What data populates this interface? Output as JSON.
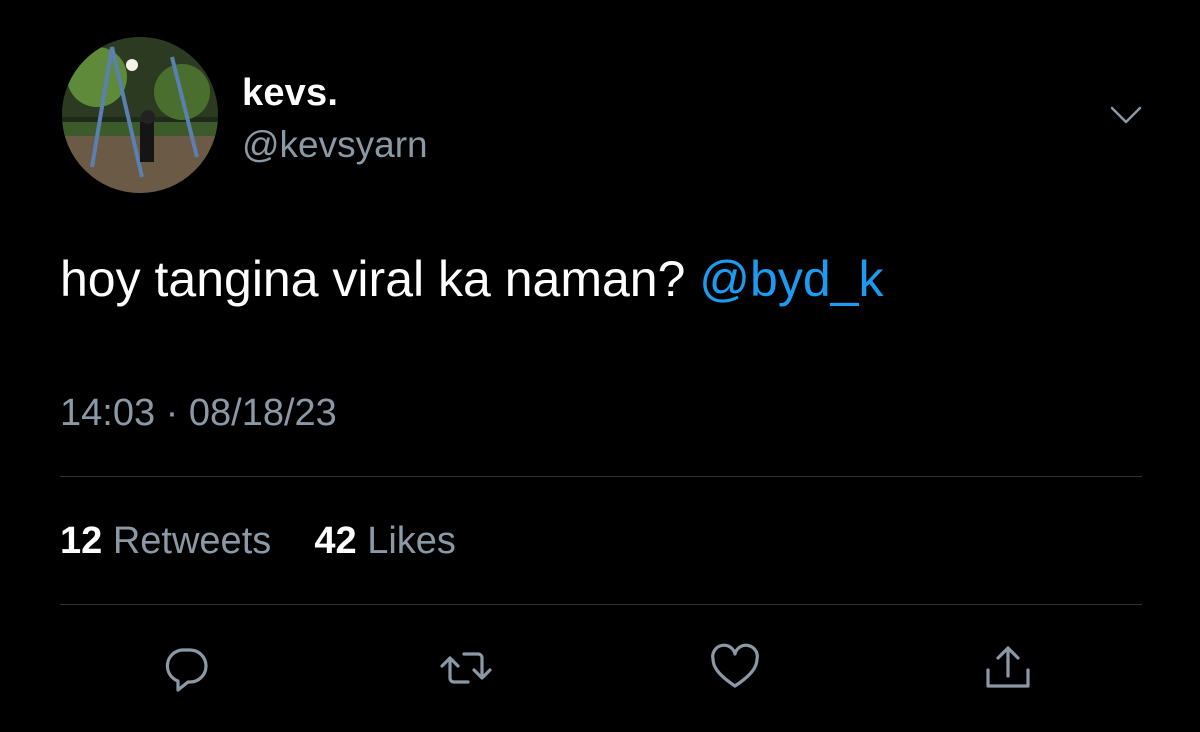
{
  "author": {
    "display_name": "kevs.",
    "handle": "@kevsyarn"
  },
  "tweet": {
    "text": "hoy tangina viral ka naman?",
    "mention": "@byd_k",
    "time": "14:03",
    "separator": "·",
    "date": "08/18/23"
  },
  "stats": {
    "retweets_count": "12",
    "retweets_label": "Retweets",
    "likes_count": "42",
    "likes_label": "Likes"
  },
  "icons": {
    "more": "chevron-down-icon",
    "reply": "reply-icon",
    "retweet": "retweet-icon",
    "like": "heart-icon",
    "share": "share-icon"
  },
  "colors": {
    "background": "#000000",
    "primary_text": "#ffffff",
    "secondary_text": "#8b98a5",
    "link": "#1d9bf0",
    "divider": "#2f3336"
  }
}
